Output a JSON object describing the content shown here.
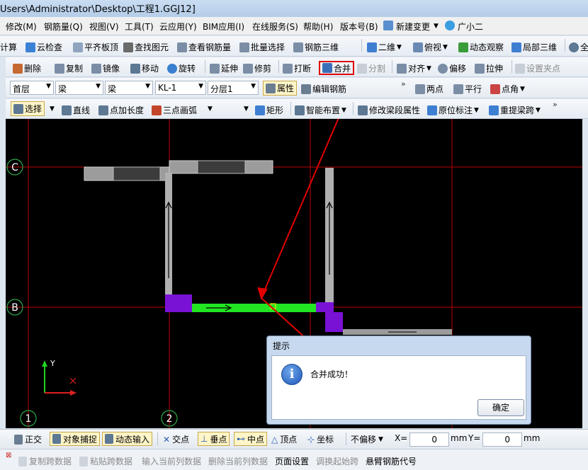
{
  "window": {
    "title": "Users\\Administrator\\Desktop\\工程1.GGJ12]"
  },
  "menu": [
    "修改(M)",
    "钢筋量(Q)",
    "视图(V)",
    "工具(T)",
    "云应用(Y)",
    "BIM应用(I)",
    "在线服务(S)",
    "帮助(H)",
    "版本号(B)",
    "新建变更",
    "广小二"
  ],
  "toolbar1": [
    "汇总计算",
    "云检查",
    "平齐板顶",
    "查找图元",
    "查看钢筋量",
    "批量选择",
    "钢筋三维",
    "二维",
    "俯视",
    "动态观察",
    "局部三维",
    "全"
  ],
  "toolbar2": [
    "删除",
    "复制",
    "镜像",
    "移动",
    "旋转",
    "延伸",
    "修剪",
    "打断",
    "合并",
    "分割",
    "对齐",
    "偏移",
    "拉伸",
    "设置夹点"
  ],
  "toolbar3": {
    "floor": "首层",
    "type1": "梁",
    "type2": "梁",
    "element": "KL-1",
    "layer": "分层1",
    "attributes": "属性",
    "edit_rebar": "编辑钢筋",
    "two_points": "两点",
    "parallel": "平行",
    "point_angle": "点角"
  },
  "toolbar4": [
    "选择",
    "直线",
    "点加长度",
    "三点画弧",
    "矩形",
    "智能布置",
    "修改梁段属性",
    "原位标注",
    "重提梁跨"
  ],
  "canvas": {
    "axis_labels": {
      "row_c": "C",
      "row_b": "B",
      "col_1": "1",
      "col_2": "2"
    },
    "coord_y": "Y",
    "colors": {
      "background": "#000000",
      "axis": "#c00000",
      "beam_gray": "#b4b4b4",
      "beam_green": "#22e622",
      "column_purple": "#7a12d6",
      "annotation": "#e00000"
    }
  },
  "dialog": {
    "title": "提示",
    "message": "合并成功！",
    "ok": "确定",
    "icon": "info-icon"
  },
  "status": {
    "items": [
      "正交",
      "对象捕捉",
      "动态输入",
      "交点",
      "垂点",
      "中点",
      "顶点",
      "坐标",
      "不偏移"
    ],
    "x_label": "X=",
    "x_value": "0",
    "x_unit": "mm",
    "y_label": "Y=",
    "y_value": "0",
    "y_unit": "mm"
  },
  "bottom": [
    "复制跨数据",
    "粘贴跨数据",
    "输入当前列数据",
    "删除当前列数据",
    "页面设置",
    "调换起始跨",
    "悬臂钢筋代号"
  ]
}
